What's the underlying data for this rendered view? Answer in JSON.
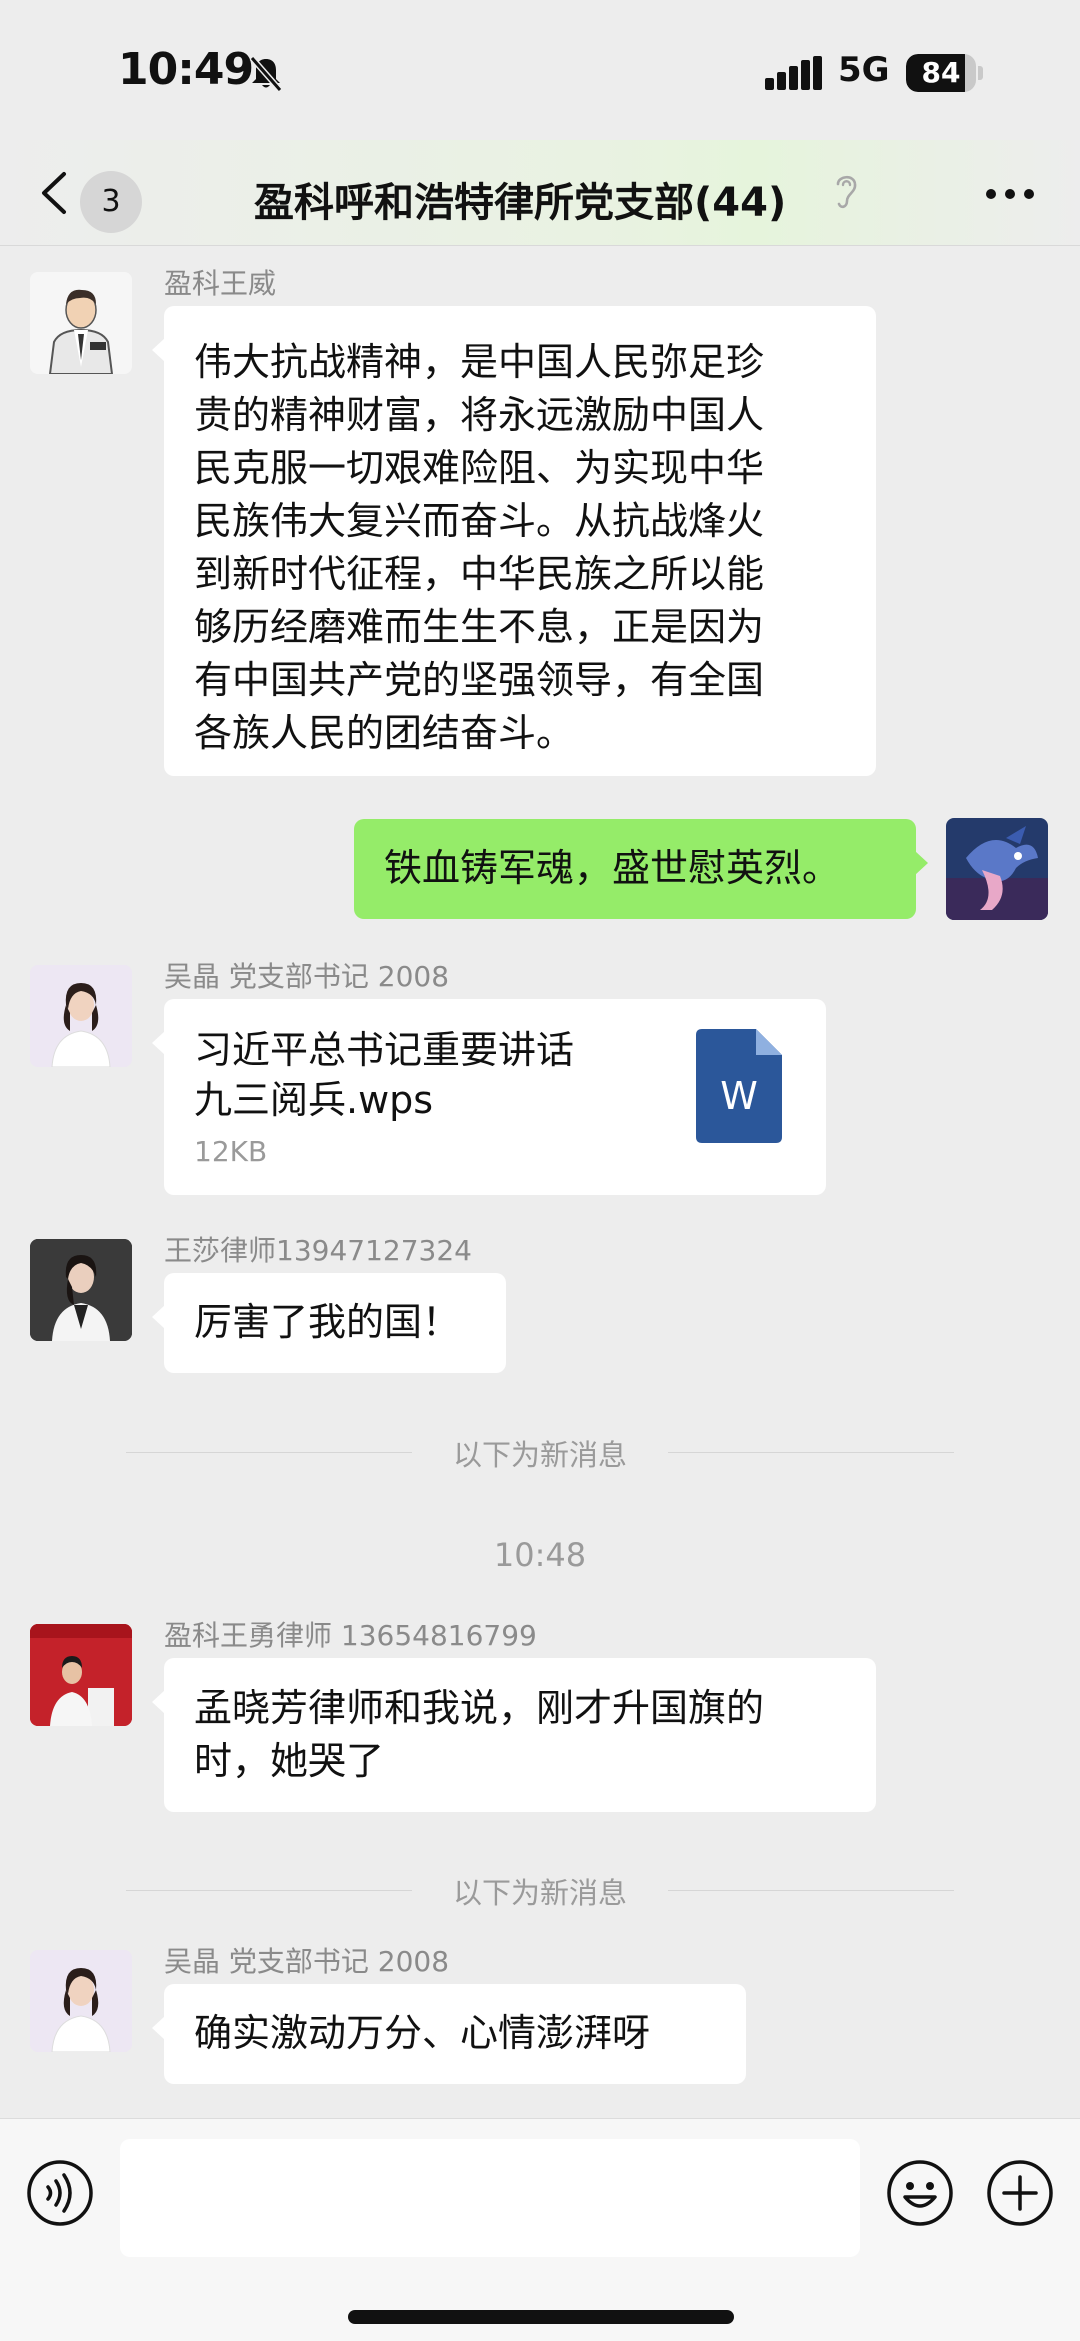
{
  "status_bar": {
    "time": "10:49",
    "network": "5G",
    "battery": "84",
    "battery_level": 0.84
  },
  "nav": {
    "unread_count": "3",
    "title": "盈科呼和浩特律所党支部(44)"
  },
  "messages": [
    {
      "sender": "盈科王威",
      "lines": [
        "伟大抗战精神，是中国人民弥足珍",
        "贵的精神财富，将永远激励中国人",
        "民克服一切艰难险阻、为实现中华",
        "民族伟大复兴而奋斗。从抗战烽火",
        "到新时代征程，中华民族之所以能",
        "够历经磨难而生生不息，正是因为",
        "有中国共产党的坚强领导，有全国",
        "各族人民的团结奋斗。"
      ]
    },
    {
      "sender": "",
      "mine": true,
      "lines": [
        "铁血铸军魂，盛世慰英烈。"
      ]
    },
    {
      "sender": "吴晶 党支部书记 2008",
      "file": {
        "name_lines": [
          "习近平总书记重要讲话",
          "九三阅兵.wps"
        ],
        "size": "12KB",
        "icon_letter": "W"
      }
    },
    {
      "sender": "王莎律师13947127324",
      "lines": [
        "厉害了我的国！"
      ]
    },
    {
      "sender": "盈科王勇律师 13654816799",
      "lines": [
        "孟晓芳律师和我说，刚才升国旗的",
        "时，她哭了"
      ]
    },
    {
      "sender": "吴晶 党支部书记 2008",
      "lines": [
        "确实激动万分、心情澎湃呀"
      ]
    }
  ],
  "dividers": {
    "new_messages_1": "以下为新消息",
    "time_1": "10:48",
    "new_messages_2": "以下为新消息"
  },
  "input": {
    "placeholder": ""
  },
  "colors": {
    "my_bubble": "#95ec69",
    "background": "#ededed",
    "wps_icon": "#2b579a"
  }
}
